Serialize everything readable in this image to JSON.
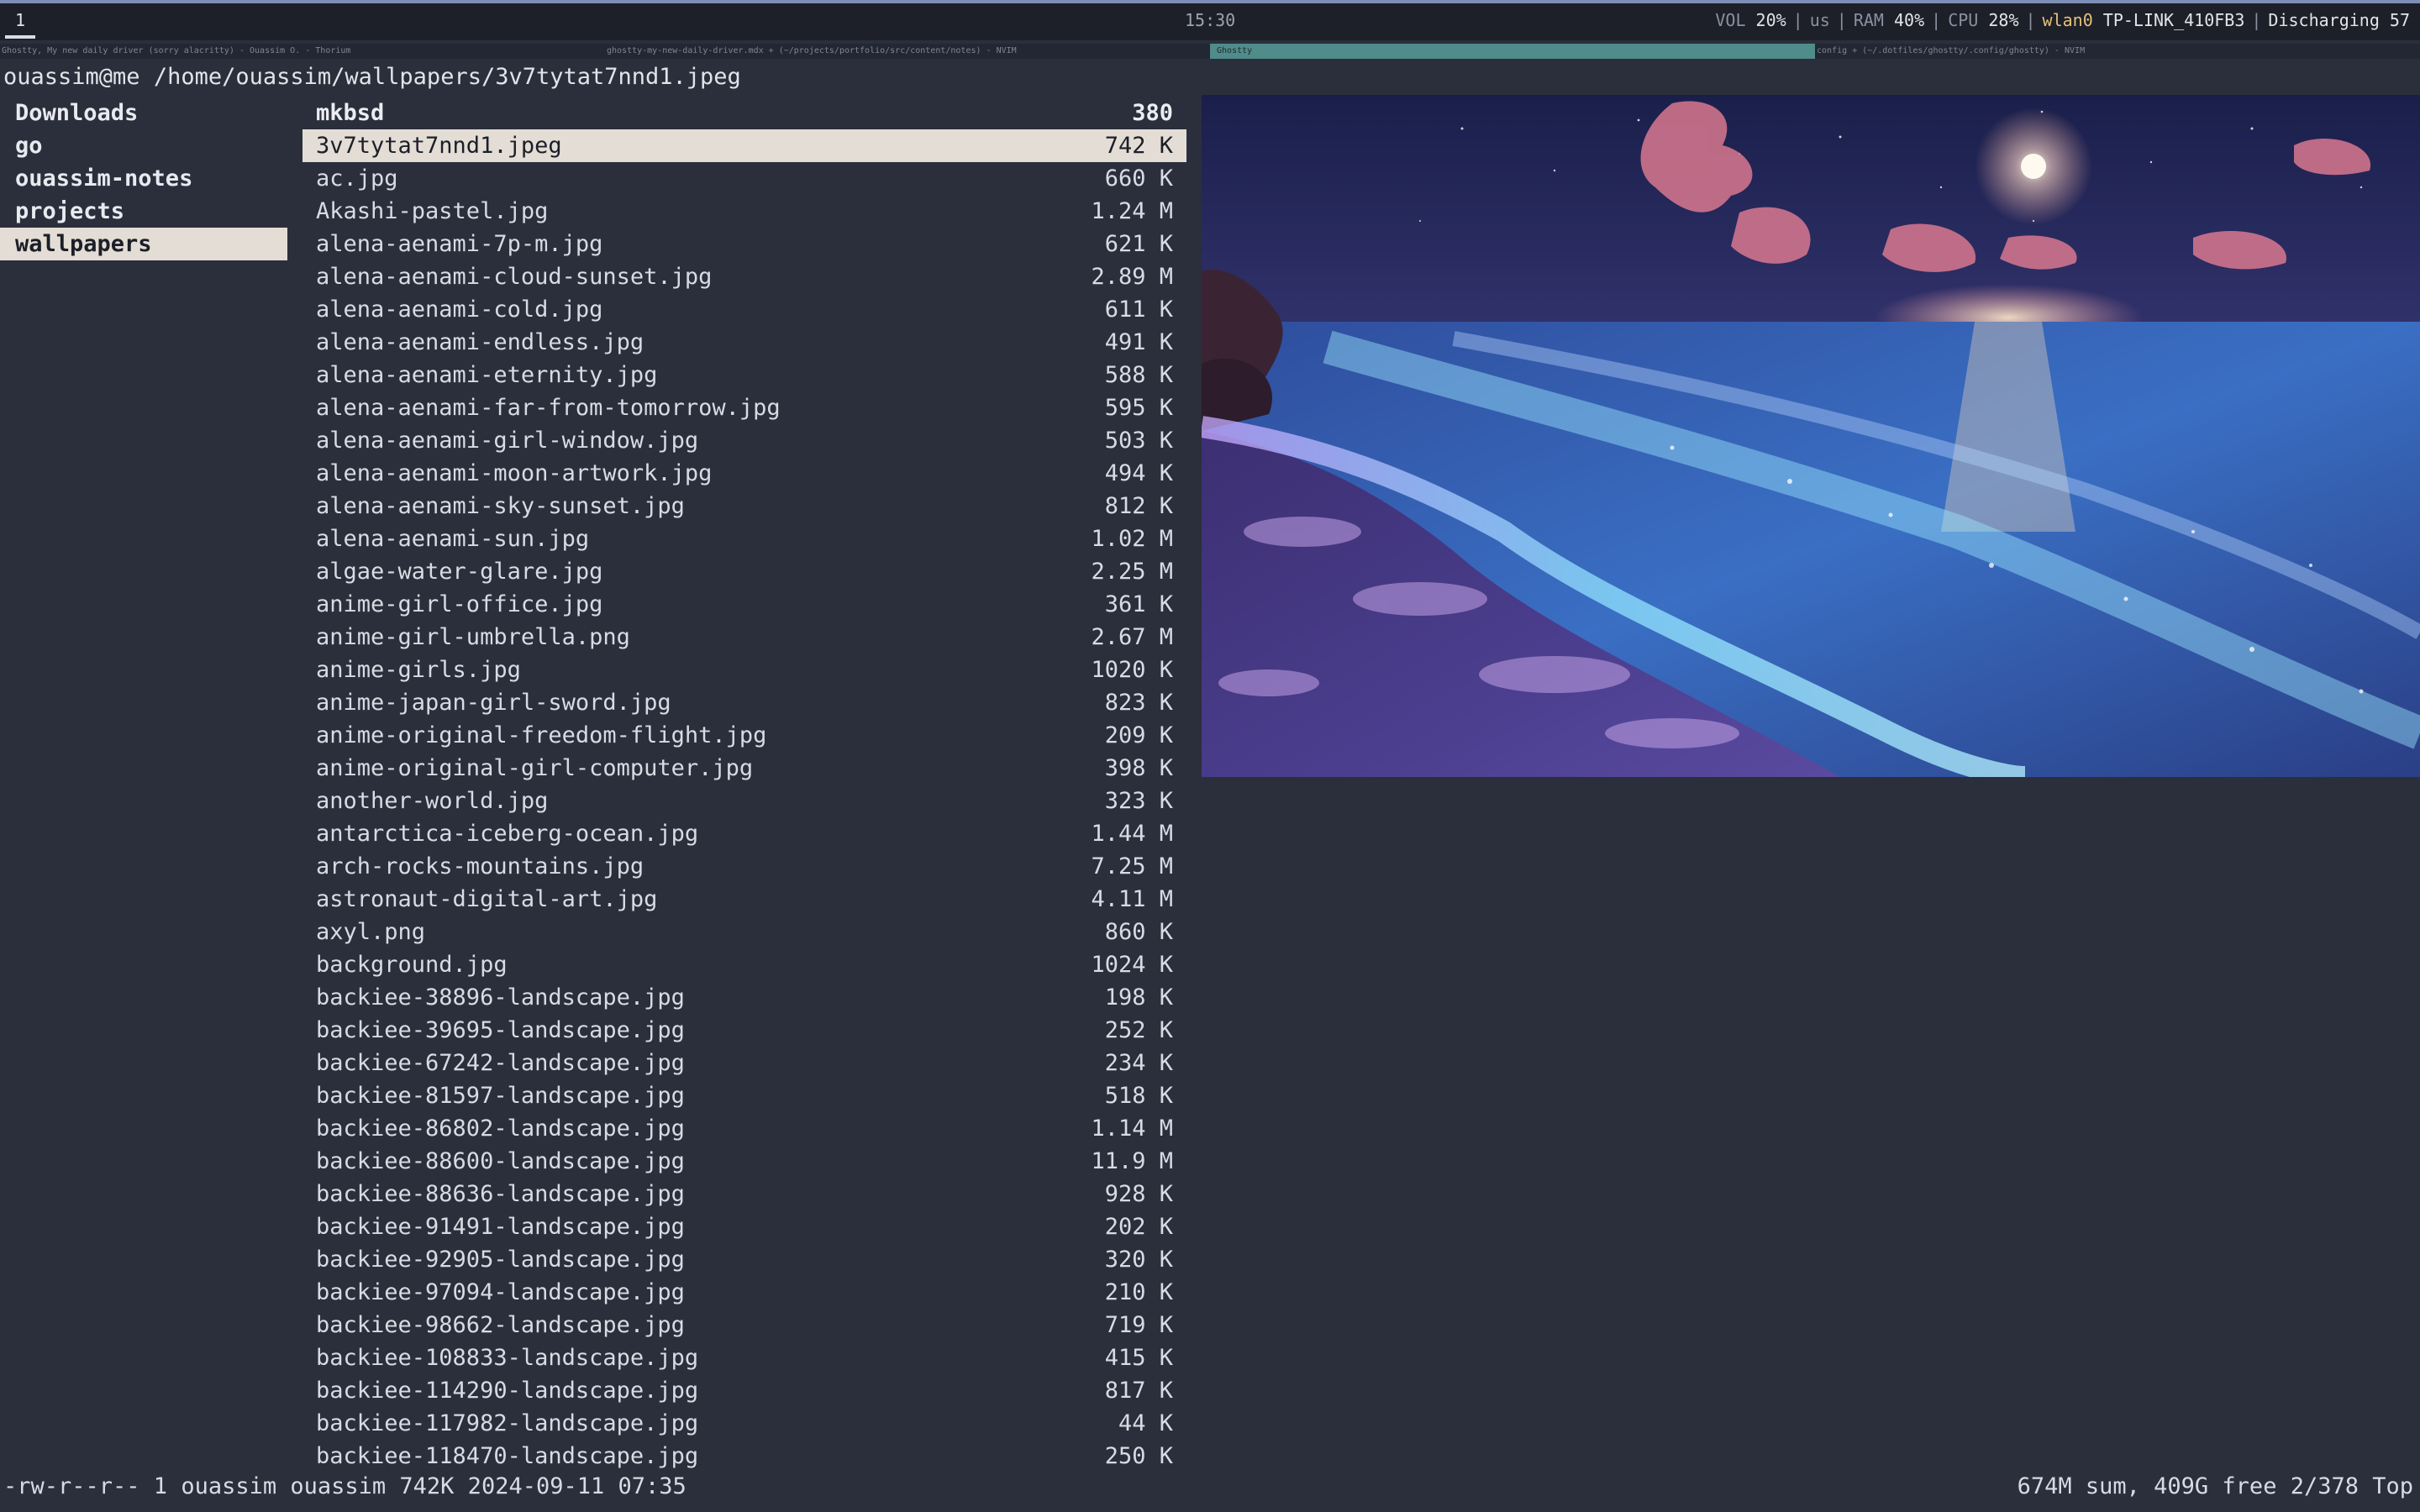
{
  "topbar": {
    "workspace": "1",
    "clock": "15:30",
    "vol_label": "VOL",
    "vol_value": "20%",
    "layout": "us",
    "ram_label": "RAM",
    "ram_value": "40%",
    "cpu_label": "CPU",
    "cpu_value": "28%",
    "net_iface": "wlan0",
    "net_ssid": "TP-LINK_410FB3",
    "battery": "Discharging 57"
  },
  "titles": {
    "win1": "Ghostty, My new daily driver (sorry alacritty) - Ouassim O. - Thorium",
    "win2": "ghostty-my-new-daily-driver.mdx + (~/projects/portfolio/src/content/notes) - NVIM",
    "win3": "Ghostty",
    "win4": "config + (~/.dotfiles/ghostty/.config/ghostty) - NVIM"
  },
  "path": {
    "user": "ouassim@me",
    "dir": "/home/ouassim/wallpapers/",
    "file": "3v7tytat7nnd1.jpeg"
  },
  "parent_dirs": [
    {
      "name": "Downloads",
      "selected": false
    },
    {
      "name": "go",
      "selected": false
    },
    {
      "name": "ouassim-notes",
      "selected": false
    },
    {
      "name": "projects",
      "selected": false
    },
    {
      "name": "wallpapers",
      "selected": true
    }
  ],
  "files": [
    {
      "name": "mkbsd",
      "size": "380",
      "dir": true
    },
    {
      "name": "3v7tytat7nnd1.jpeg",
      "size": "742 K",
      "selected": true
    },
    {
      "name": "ac.jpg",
      "size": "660 K"
    },
    {
      "name": "Akashi-pastel.jpg",
      "size": "1.24 M"
    },
    {
      "name": "alena-aenami-7p-m.jpg",
      "size": "621 K"
    },
    {
      "name": "alena-aenami-cloud-sunset.jpg",
      "size": "2.89 M"
    },
    {
      "name": "alena-aenami-cold.jpg",
      "size": "611 K"
    },
    {
      "name": "alena-aenami-endless.jpg",
      "size": "491 K"
    },
    {
      "name": "alena-aenami-eternity.jpg",
      "size": "588 K"
    },
    {
      "name": "alena-aenami-far-from-tomorrow.jpg",
      "size": "595 K"
    },
    {
      "name": "alena-aenami-girl-window.jpg",
      "size": "503 K"
    },
    {
      "name": "alena-aenami-moon-artwork.jpg",
      "size": "494 K"
    },
    {
      "name": "alena-aenami-sky-sunset.jpg",
      "size": "812 K"
    },
    {
      "name": "alena-aenami-sun.jpg",
      "size": "1.02 M"
    },
    {
      "name": "algae-water-glare.jpg",
      "size": "2.25 M"
    },
    {
      "name": "anime-girl-office.jpg",
      "size": "361 K"
    },
    {
      "name": "anime-girl-umbrella.png",
      "size": "2.67 M"
    },
    {
      "name": "anime-girls.jpg",
      "size": "1020 K"
    },
    {
      "name": "anime-japan-girl-sword.jpg",
      "size": "823 K"
    },
    {
      "name": "anime-original-freedom-flight.jpg",
      "size": "209 K"
    },
    {
      "name": "anime-original-girl-computer.jpg",
      "size": "398 K"
    },
    {
      "name": "another-world.jpg",
      "size": "323 K"
    },
    {
      "name": "antarctica-iceberg-ocean.jpg",
      "size": "1.44 M"
    },
    {
      "name": "arch-rocks-mountains.jpg",
      "size": "7.25 M"
    },
    {
      "name": "astronaut-digital-art.jpg",
      "size": "4.11 M"
    },
    {
      "name": "axyl.png",
      "size": "860 K"
    },
    {
      "name": "background.jpg",
      "size": "1024 K"
    },
    {
      "name": "backiee-38896-landscape.jpg",
      "size": "198 K"
    },
    {
      "name": "backiee-39695-landscape.jpg",
      "size": "252 K"
    },
    {
      "name": "backiee-67242-landscape.jpg",
      "size": "234 K"
    },
    {
      "name": "backiee-81597-landscape.jpg",
      "size": "518 K"
    },
    {
      "name": "backiee-86802-landscape.jpg",
      "size": "1.14 M"
    },
    {
      "name": "backiee-88600-landscape.jpg",
      "size": "11.9 M"
    },
    {
      "name": "backiee-88636-landscape.jpg",
      "size": "928 K"
    },
    {
      "name": "backiee-91491-landscape.jpg",
      "size": "202 K"
    },
    {
      "name": "backiee-92905-landscape.jpg",
      "size": "320 K"
    },
    {
      "name": "backiee-97094-landscape.jpg",
      "size": "210 K"
    },
    {
      "name": "backiee-98662-landscape.jpg",
      "size": "719 K"
    },
    {
      "name": "backiee-108833-landscape.jpg",
      "size": "415 K"
    },
    {
      "name": "backiee-114290-landscape.jpg",
      "size": "817 K"
    },
    {
      "name": "backiee-117982-landscape.jpg",
      "size": "44 K"
    },
    {
      "name": "backiee-118470-landscape.jpg",
      "size": "250 K"
    }
  ],
  "preview": {
    "icon": "wallpaper-preview-image"
  },
  "status": {
    "left": "-rw-r--r-- 1 ouassim ouassim 742K 2024-09-11 07:35",
    "right": "674M sum, 409G free  2/378  Top"
  },
  "colors": {
    "background": "#2b2f3b",
    "selection": "#e3ddd6",
    "accent_wlan": "#e4c07a",
    "active_window": "#4f8c8a"
  }
}
